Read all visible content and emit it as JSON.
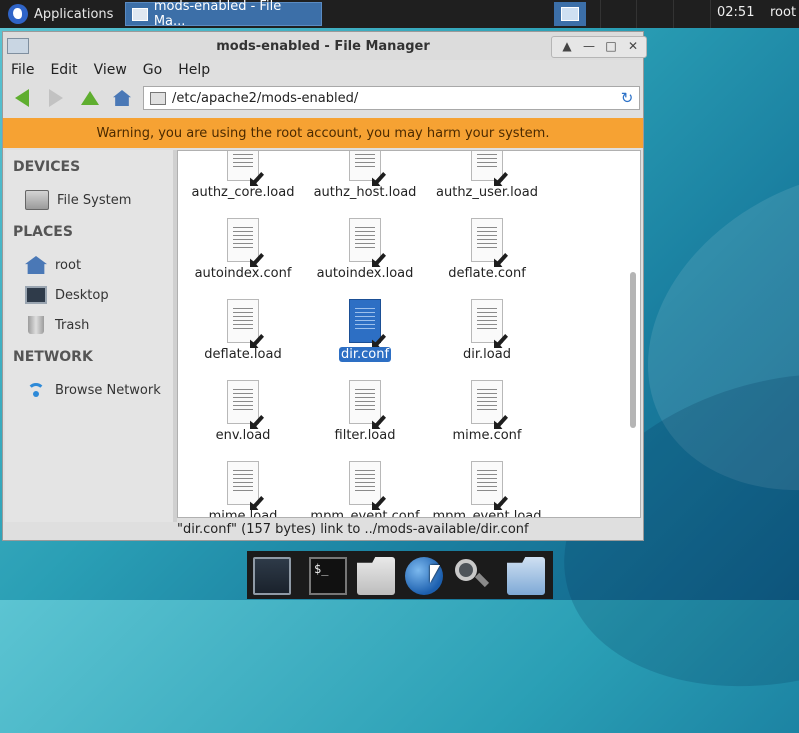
{
  "top_panel": {
    "applications_label": "Applications",
    "task_label": "mods-enabled - File Ma...",
    "clock": "02:51",
    "user": "root"
  },
  "window": {
    "title": "mods-enabled - File Manager",
    "controls": {
      "up": "▲",
      "minimize": "—",
      "maximize": "□",
      "close": "✕"
    }
  },
  "menu": [
    "File",
    "Edit",
    "View",
    "Go",
    "Help"
  ],
  "toolbar": {
    "location": "/etc/apache2/mods-enabled/"
  },
  "warning": "Warning, you are using the root account, you may harm your system.",
  "sidebar": {
    "devices_heading": "DEVICES",
    "devices": [
      {
        "label": "File System",
        "icon": "drive-icon"
      }
    ],
    "places_heading": "PLACES",
    "places": [
      {
        "label": "root",
        "icon": "home-icon"
      },
      {
        "label": "Desktop",
        "icon": "desktop-icon"
      },
      {
        "label": "Trash",
        "icon": "trash-icon"
      }
    ],
    "network_heading": "NETWORK",
    "network": [
      {
        "label": "Browse Network",
        "icon": "wifi-icon"
      }
    ]
  },
  "files": [
    {
      "name": "authz_core.load"
    },
    {
      "name": "authz_host.load"
    },
    {
      "name": "authz_user.load"
    },
    {
      "name": "autoindex.conf"
    },
    {
      "name": "autoindex.load"
    },
    {
      "name": "deflate.conf"
    },
    {
      "name": "deflate.load"
    },
    {
      "name": "dir.conf",
      "selected": true
    },
    {
      "name": "dir.load"
    },
    {
      "name": "env.load"
    },
    {
      "name": "filter.load"
    },
    {
      "name": "mime.conf"
    },
    {
      "name": "mime.load"
    },
    {
      "name": "mpm_event.conf"
    },
    {
      "name": "mpm_event.load"
    }
  ],
  "status": "\"dir.conf\" (157 bytes) link to ../mods-available/dir.conf",
  "colors": {
    "warning_bg": "#f6a233",
    "selection": "#2d6fc4",
    "panel": "#1f1f1f"
  },
  "dock": {
    "terminal_glyph": "$_"
  }
}
